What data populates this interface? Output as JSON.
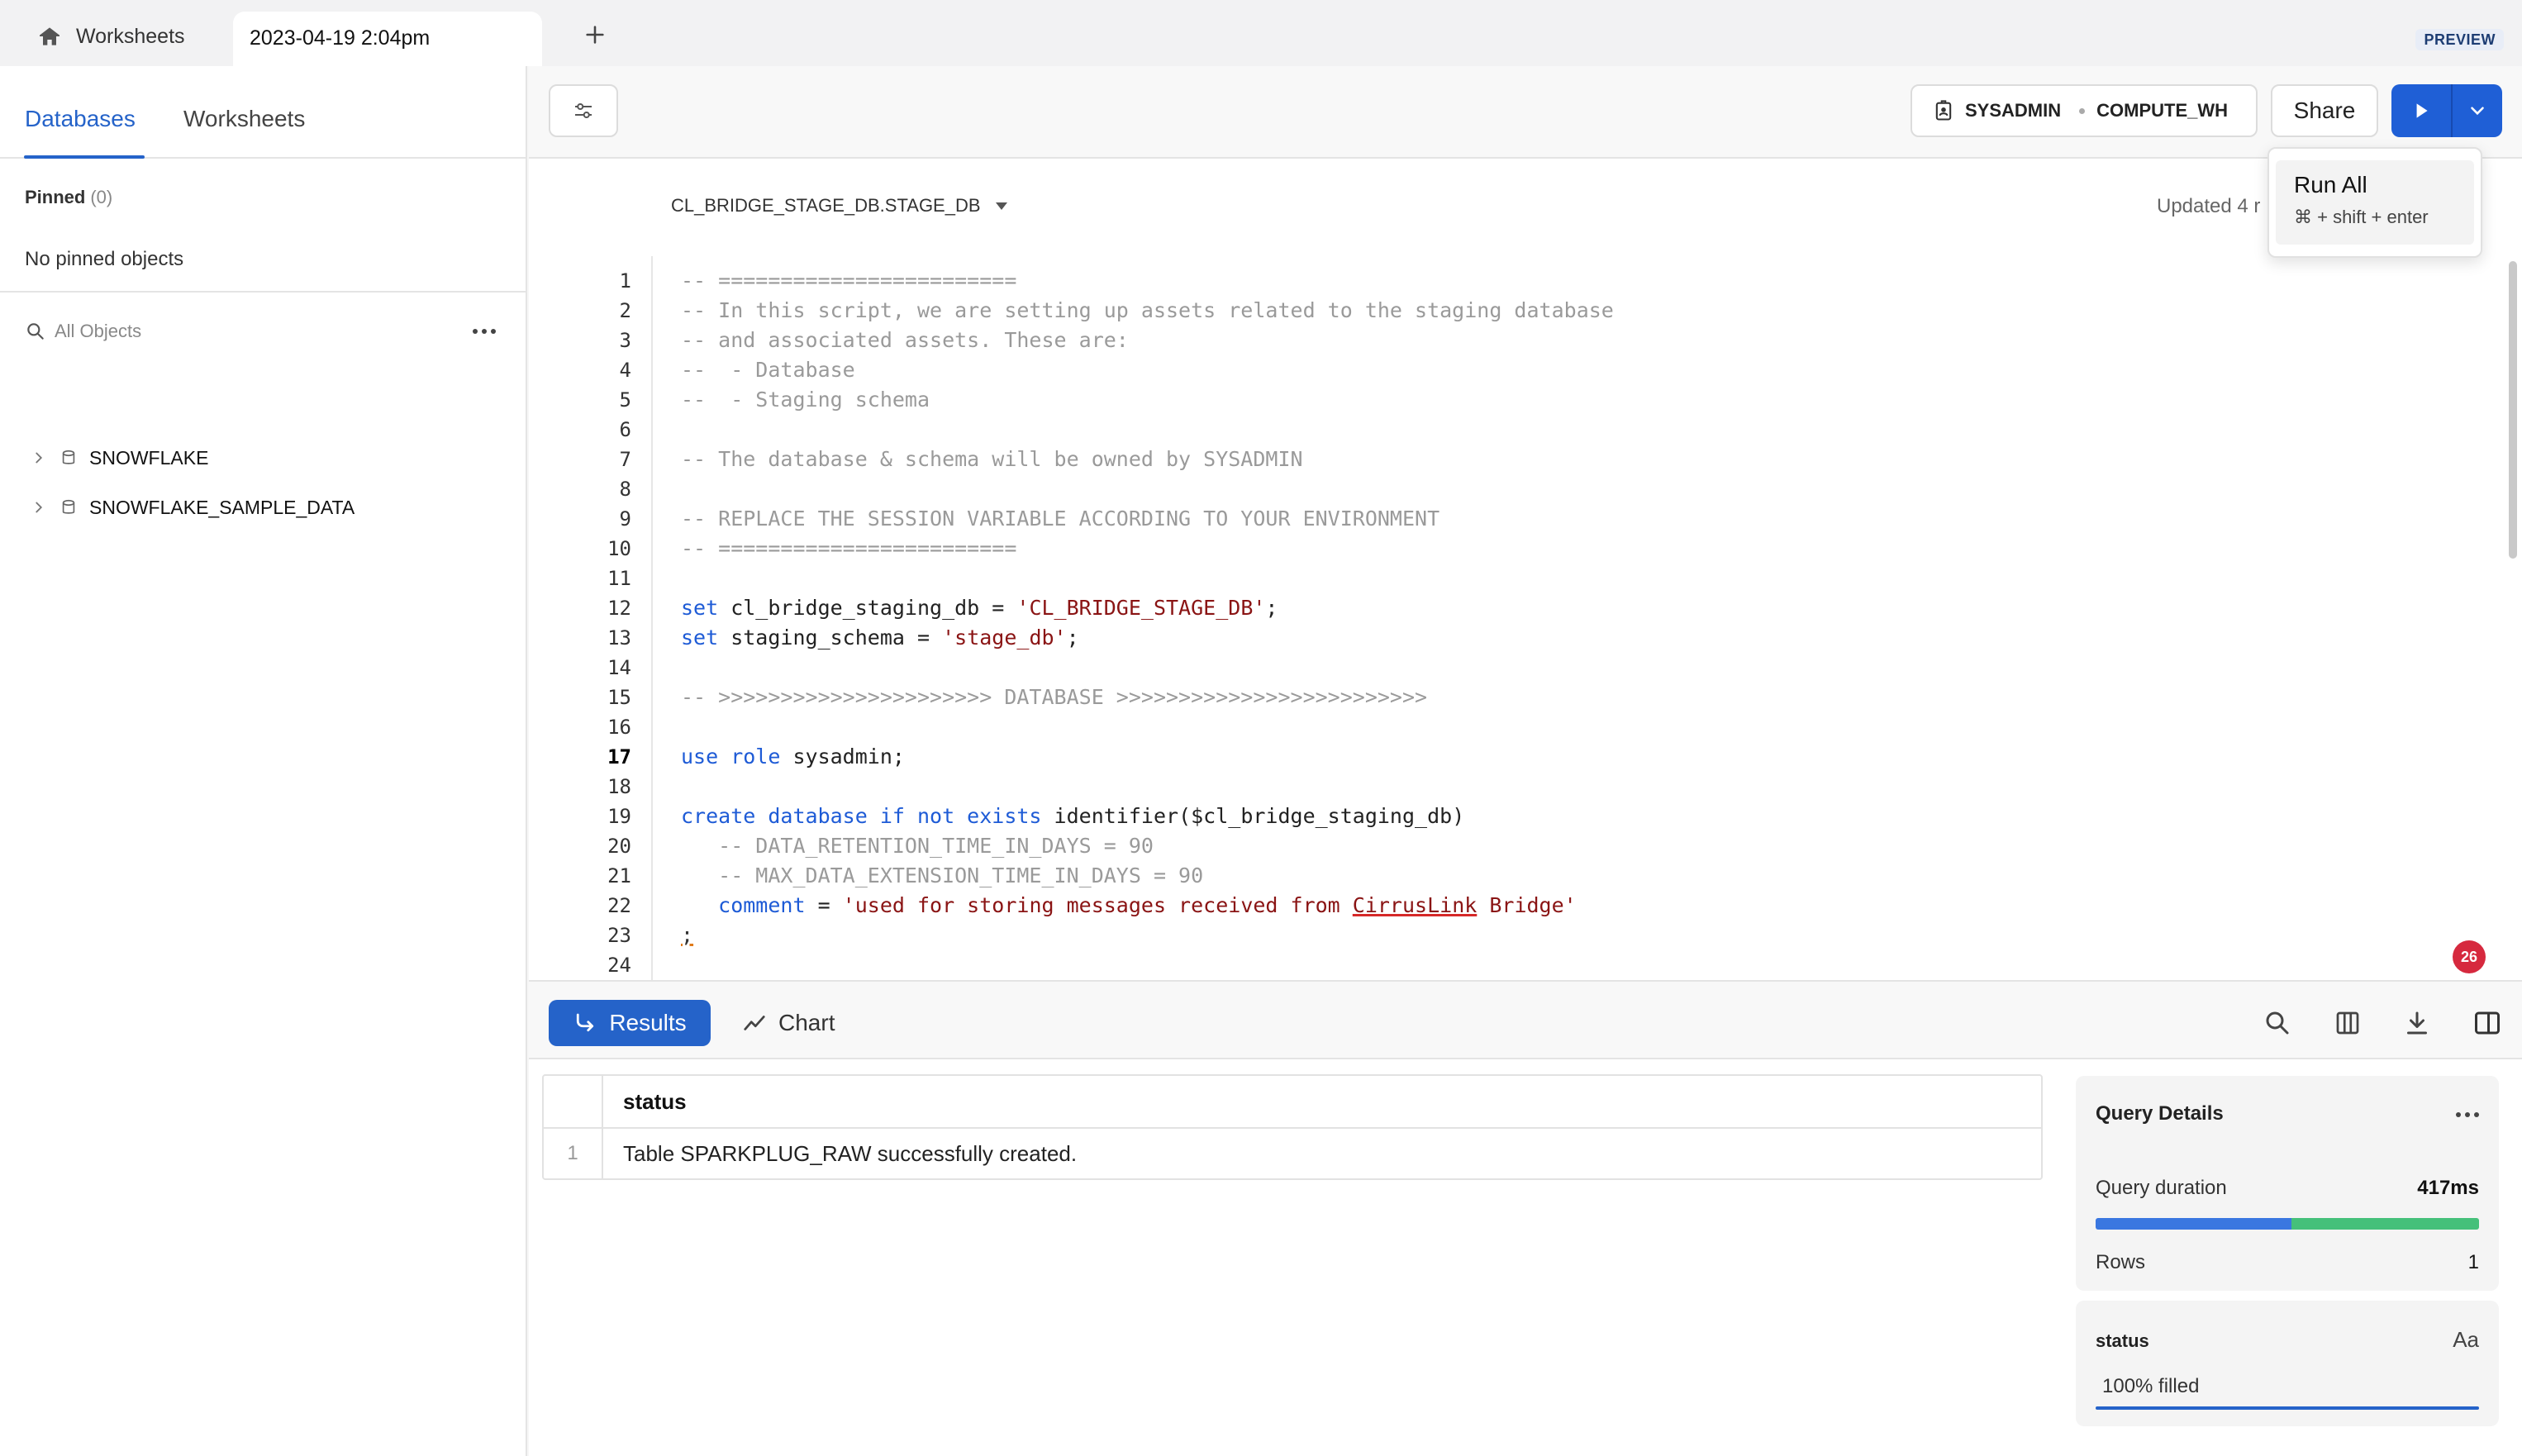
{
  "topbar": {
    "home_tab_label": "Worksheets",
    "active_tab_label": "2023-04-19 2:04pm",
    "preview_badge": "PREVIEW"
  },
  "sidebar": {
    "tabs": [
      "Databases",
      "Worksheets"
    ],
    "active_tab": "Databases",
    "pinned_label": "Pinned",
    "pinned_count": "(0)",
    "no_pinned_text": "No pinned objects",
    "search_placeholder": "All Objects",
    "tree": [
      {
        "label": "SNOWFLAKE",
        "icon": "database-icon"
      },
      {
        "label": "SNOWFLAKE_SAMPLE_DATA",
        "icon": "database-icon"
      }
    ]
  },
  "toolbar": {
    "role": "SYSADMIN",
    "warehouse": "COMPUTE_WH",
    "share_label": "Share"
  },
  "dropdown": {
    "label": "Run All",
    "shortcut": "⌘ + shift + enter"
  },
  "editor": {
    "context": "CL_BRIDGE_STAGE_DB.STAGE_DB",
    "updated_text": "Updated 4 r",
    "current_line": 17,
    "error_count": "26",
    "lines": [
      [
        {
          "t": "cm",
          "v": "-- ========================"
        }
      ],
      [
        {
          "t": "cm",
          "v": "-- In this script, we are setting up assets related to the staging database"
        }
      ],
      [
        {
          "t": "cm",
          "v": "-- and associated assets. These are:"
        }
      ],
      [
        {
          "t": "cm",
          "v": "--  - Database"
        }
      ],
      [
        {
          "t": "cm",
          "v": "--  - Staging schema"
        }
      ],
      [],
      [
        {
          "t": "cm",
          "v": "-- The database & schema will be owned by SYSADMIN"
        }
      ],
      [],
      [
        {
          "t": "cm",
          "v": "-- REPLACE THE SESSION VARIABLE ACCORDING TO YOUR ENVIRONMENT"
        }
      ],
      [
        {
          "t": "cm",
          "v": "-- ========================"
        }
      ],
      [],
      [
        {
          "t": "kw",
          "v": "set"
        },
        {
          "t": "tx",
          "v": " cl_bridge_staging_db = "
        },
        {
          "t": "st",
          "v": "'CL_BRIDGE_STAGE_DB'"
        },
        {
          "t": "tx",
          "v": ";"
        }
      ],
      [
        {
          "t": "kw",
          "v": "set"
        },
        {
          "t": "tx",
          "v": " staging_schema = "
        },
        {
          "t": "st",
          "v": "'stage_db'"
        },
        {
          "t": "tx",
          "v": ";"
        }
      ],
      [],
      [
        {
          "t": "cm",
          "v": "-- >>>>>>>>>>>>>>>>>>>>>> DATABASE >>>>>>>>>>>>>>>>>>>>>>>>>"
        }
      ],
      [],
      [
        {
          "t": "kw",
          "v": "use role"
        },
        {
          "t": "tx",
          "v": " sysadmin;"
        }
      ],
      [],
      [
        {
          "t": "kw",
          "v": "create database if not exists"
        },
        {
          "t": "tx",
          "v": " identifier($cl_bridge_staging_db)"
        }
      ],
      [
        {
          "t": "cm",
          "v": "   -- DATA_RETENTION_TIME_IN_DAYS = 90"
        }
      ],
      [
        {
          "t": "cm",
          "v": "   -- MAX_DATA_EXTENSION_TIME_IN_DAYS = 90"
        }
      ],
      [
        {
          "t": "tx",
          "v": "   "
        },
        {
          "t": "kw",
          "v": "comment"
        },
        {
          "t": "tx",
          "v": " = "
        },
        {
          "t": "st",
          "v": "'used for storing messages received from "
        },
        {
          "t": "sq",
          "v": "CirrusLink"
        },
        {
          "t": "st",
          "v": " Bridge'"
        }
      ],
      [
        {
          "t": "semi",
          "v": ";"
        }
      ],
      []
    ]
  },
  "results": {
    "tabs": [
      "Results",
      "Chart"
    ],
    "active_tab": "Results",
    "table": {
      "columns": [
        "status"
      ],
      "rows": [
        {
          "index": "1",
          "values": [
            "Table SPARKPLUG_RAW successfully created."
          ]
        }
      ]
    },
    "query_details": {
      "title": "Query Details",
      "duration_label": "Query duration",
      "duration_value": "417ms",
      "rows_label": "Rows",
      "rows_value": "1",
      "bar_split_fraction": 0.51
    },
    "column_stats": {
      "column": "status",
      "type_icon_label": "Aa",
      "fill_text": "100% filled",
      "fill_fraction": 1.0
    }
  },
  "colors": {
    "accent": "#2563c9",
    "run_button": "#1f5fd6",
    "comment": "#9a9a9a",
    "keyword": "#1e5bd6",
    "string": "#8a1414",
    "error_badge": "#d6293e",
    "duration_bar_a": "#3a77e0",
    "duration_bar_b": "#45c07a"
  }
}
